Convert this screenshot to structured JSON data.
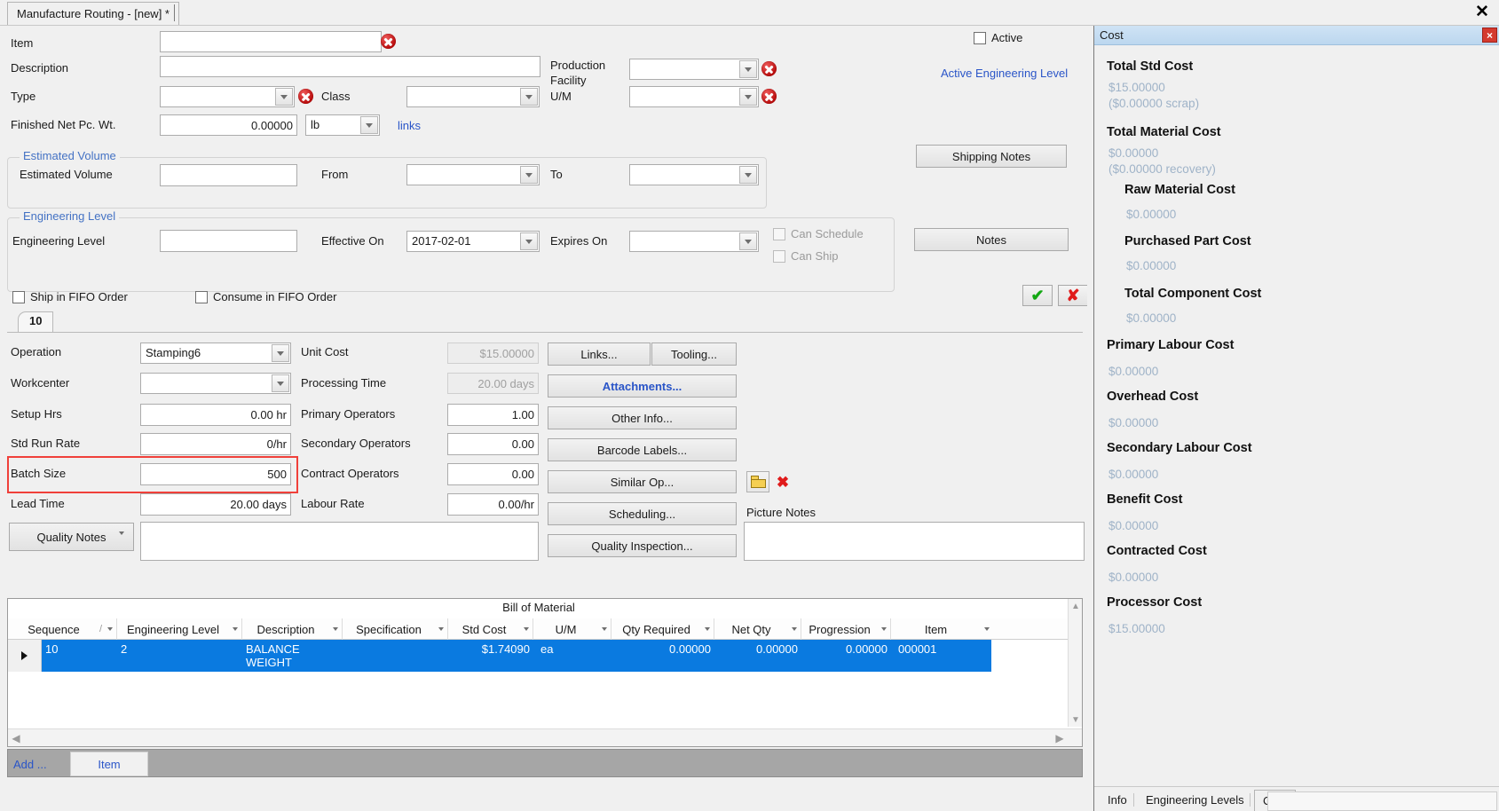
{
  "window": {
    "tab_title": "Manufacture Routing - [new] *",
    "close_glyph": "✕"
  },
  "form": {
    "item_label": "Item",
    "item_value": "",
    "description_label": "Description",
    "description_value": "",
    "type_label": "Type",
    "type_value": "",
    "class_label": "Class",
    "class_value": "",
    "finished_net_label": "Finished Net Pc. Wt.",
    "finished_net_value": "0.00000",
    "finished_net_uom": "lb",
    "links_label": "links",
    "production_facility_label_1": "Production",
    "production_facility_label_2": "Facility",
    "production_facility_value": "",
    "uom_label": "U/M",
    "uom_value": "",
    "active_label": "Active",
    "active_engineering_level_label": "Active Engineering Level",
    "shipping_notes_label": "Shipping Notes",
    "notes_label": "Notes"
  },
  "estimated_volume": {
    "group_label": "Estimated Volume",
    "field_label": "Estimated Volume",
    "field_value": "",
    "from_label": "From",
    "from_value": "",
    "to_label": "To",
    "to_value": ""
  },
  "engineering_level": {
    "group_label": "Engineering Level",
    "field_label": "Engineering Level",
    "field_value": "",
    "effective_on_label": "Effective On",
    "effective_on_value": "2017-02-01",
    "expires_on_label": "Expires On",
    "expires_on_value": "",
    "can_schedule_label": "Can Schedule",
    "can_ship_label": "Can Ship"
  },
  "fifo": {
    "ship_label": "Ship in FIFO Order",
    "consume_label": "Consume in FIFO Order"
  },
  "operation": {
    "tab_label": "10",
    "operation_label": "Operation",
    "operation_value": "Stamping6",
    "workcenter_label": "Workcenter",
    "workcenter_value": "",
    "setup_hrs_label": "Setup Hrs",
    "setup_hrs_value": "0.00 hr",
    "std_run_rate_label": "Std Run Rate",
    "std_run_rate_value": "0/hr",
    "batch_size_label": "Batch Size",
    "batch_size_value": "500",
    "lead_time_label": "Lead Time",
    "lead_time_value": "20.00 days",
    "unit_cost_label": "Unit Cost",
    "unit_cost_value": "$15.00000",
    "processing_time_label": "Processing Time",
    "processing_time_value": "20.00 days",
    "primary_operators_label": "Primary Operators",
    "primary_operators_value": "1.00",
    "secondary_operators_label": "Secondary Operators",
    "secondary_operators_value": "0.00",
    "contract_operators_label": "Contract Operators",
    "contract_operators_value": "0.00",
    "labour_rate_label": "Labour Rate",
    "labour_rate_value": "0.00/hr",
    "quality_notes_label": "Quality Notes",
    "quality_notes_value": "",
    "picture_notes_label": "Picture Notes",
    "picture_notes_value": "",
    "buttons": {
      "links": "Links...",
      "tooling": "Tooling...",
      "attachments": "Attachments...",
      "other_info": "Other Info...",
      "barcode_labels": "Barcode Labels...",
      "similar_op": "Similar Op...",
      "scheduling": "Scheduling...",
      "quality_inspection": "Quality Inspection..."
    }
  },
  "bom": {
    "caption": "Bill of Material",
    "columns": [
      "Sequence",
      "Engineering Level",
      "Description",
      "Specification",
      "Std Cost",
      "U/M",
      "Qty Required",
      "Net Qty",
      "Progression",
      "Item"
    ],
    "sort_marker": "/",
    "rows": [
      {
        "sequence": "10",
        "engineering_level": "2",
        "description": "BALANCE WEIGHT",
        "specification": "",
        "std_cost": "$1.74090",
        "uom": "ea",
        "qty_required": "0.00000",
        "net_qty": "0.00000",
        "progression": "0.00000",
        "item": "000001"
      }
    ]
  },
  "bottom_bar": {
    "add_label": "Add ...",
    "item_label": "Item"
  },
  "cost_panel": {
    "title": "Cost",
    "close_glyph": "×",
    "entries": [
      {
        "label": "Total Std Cost",
        "value": "$15.00000",
        "sub": "($0.00000 scrap)",
        "indent": 0
      },
      {
        "label": "Total Material Cost",
        "value": "$0.00000",
        "sub": "($0.00000 recovery)",
        "indent": 0
      },
      {
        "label": "Raw Material Cost",
        "value": "$0.00000",
        "sub": "",
        "indent": 1
      },
      {
        "label": "Purchased Part Cost",
        "value": "$0.00000",
        "sub": "",
        "indent": 1
      },
      {
        "label": "Total Component Cost",
        "value": "$0.00000",
        "sub": "",
        "indent": 1
      },
      {
        "label": "Primary Labour Cost",
        "value": "$0.00000",
        "sub": "",
        "indent": 0
      },
      {
        "label": "Overhead Cost",
        "value": "$0.00000",
        "sub": "",
        "indent": 0
      },
      {
        "label": "Secondary Labour Cost",
        "value": "$0.00000",
        "sub": "",
        "indent": 0
      },
      {
        "label": "Benefit Cost",
        "value": "$0.00000",
        "sub": "",
        "indent": 0
      },
      {
        "label": "Contracted Cost",
        "value": "$0.00000",
        "sub": "",
        "indent": 0
      },
      {
        "label": "Processor Cost",
        "value": "$15.00000",
        "sub": "",
        "indent": 0
      }
    ],
    "tabs": [
      {
        "label": "Info",
        "active": false
      },
      {
        "label": "Engineering Levels",
        "active": false
      },
      {
        "label": "Cost",
        "active": true
      }
    ]
  },
  "colors": {
    "accent_blue": "#2a55c8",
    "selection_blue": "#0a7ae0",
    "error_red": "#b80d0d",
    "highlight_red": "#f0403a"
  }
}
